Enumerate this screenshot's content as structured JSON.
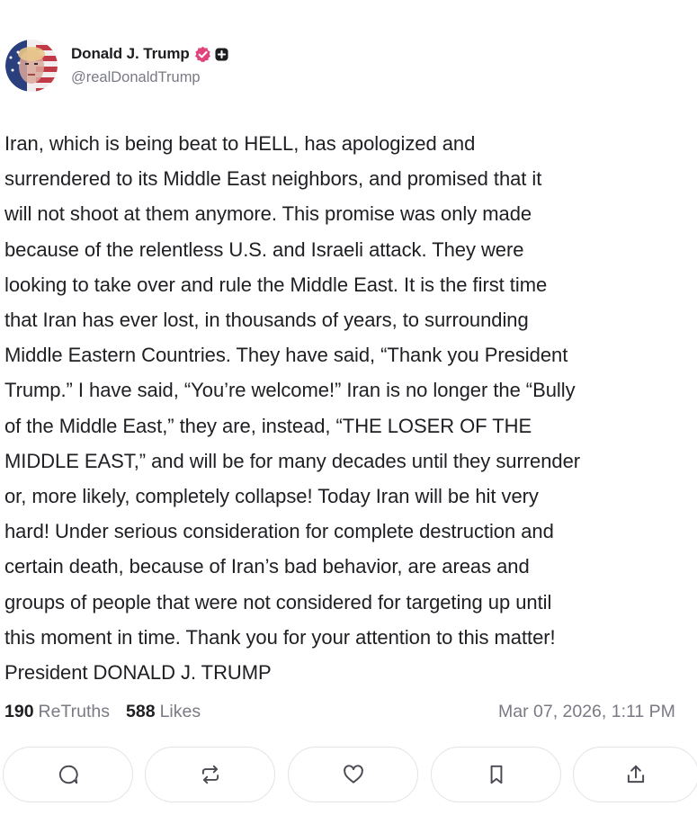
{
  "author": {
    "display_name": "Donald J. Trump",
    "handle": "@realDonaldTrump",
    "avatar_icon": "flag-portrait-avatar",
    "verified_icon": "verified-badge-icon",
    "verified_color": "#e0447c"
  },
  "post": {
    "text": "Iran, which is being beat to HELL, has apologized and\nsurrendered to its Middle East neighbors, and promised that it\nwill not shoot at them anymore. This promise was only made\nbecause of the relentless U.S. and Israeli attack. They were\nlooking to take over and rule the Middle East. It is the first time\nthat Iran has ever lost, in thousands of years, to surrounding\nMiddle Eastern Countries. They have said, “Thank you President\nTrump.” I have said, “You’re welcome!” Iran is no longer the “Bully\nof the Middle East,” they are, instead, “THE LOSER OF THE\nMIDDLE EAST,” and will be for many decades until they surrender\nor, more likely, completely collapse! Today Iran will be hit very\nhard! Under serious consideration for complete destruction and\ncertain death, because of Iran’s bad behavior, are areas and\ngroups of people that were not considered for targeting up until\nthis moment in time. Thank you for your attention to this matter!\nPresident DONALD J. TRUMP"
  },
  "stats": {
    "retruths_count": "190",
    "retruths_label": "ReTruths",
    "likes_count": "588",
    "likes_label": "Likes",
    "timestamp": "Mar 07, 2026, 1:11 PM"
  },
  "actions": [
    {
      "name": "reply",
      "icon": "comment-icon"
    },
    {
      "name": "retruth",
      "icon": "repost-icon"
    },
    {
      "name": "like",
      "icon": "heart-icon"
    },
    {
      "name": "bookmark",
      "icon": "bookmark-icon"
    },
    {
      "name": "share",
      "icon": "share-icon"
    }
  ]
}
